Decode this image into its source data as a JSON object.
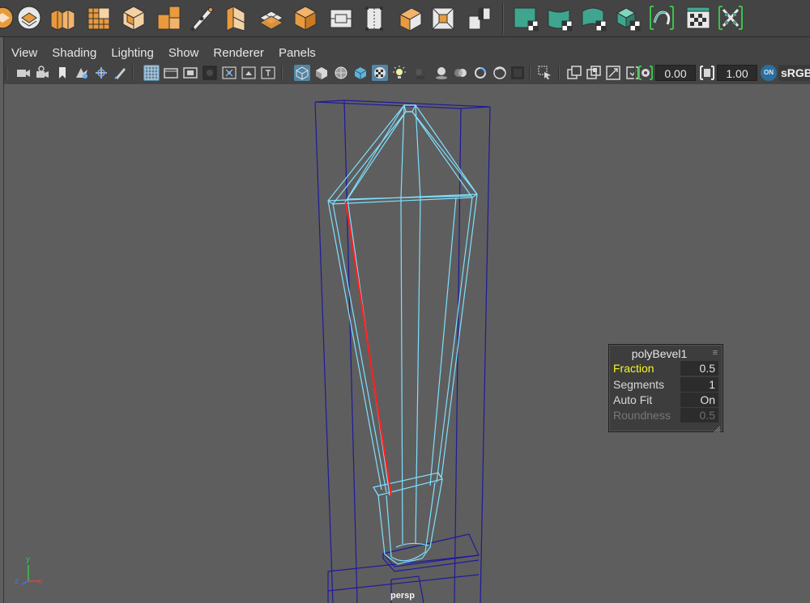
{
  "shelf": {
    "icons": [
      "poly-sphere-icon",
      "poly-cylinder-icon",
      "cube-group-icon",
      "grid-plane-icon",
      "cube-outline-icon",
      "cube-split-icon",
      "pen-edge-icon",
      "cube-slice-icon",
      "grid-bevel-icon",
      "cube-orange-icon",
      "bridge-icon",
      "extrude-outline-icon",
      "merge-icon",
      "target-icon",
      "offset-loop-icon",
      "uv-planar-icon",
      "uv-cylindrical-icon",
      "uv-spherical-icon",
      "uv-auto-icon",
      "uv-unfold-icon",
      "uv-layout-icon",
      "uv-cut-icon"
    ]
  },
  "menu": {
    "view": "View",
    "shading": "Shading",
    "lighting": "Lighting",
    "show": "Show",
    "renderer": "Renderer",
    "panels": "Panels"
  },
  "toolbar": {
    "gamma_value": "0.00",
    "exposure_value": "1.00",
    "color_space": "sRGB",
    "on_badge": "ON"
  },
  "viewport": {
    "camera_label": "persp",
    "axis_y": "y",
    "axis_z": "z",
    "axis_x": "x"
  },
  "hud": {
    "title": "polyBevel1",
    "rows": [
      {
        "label": "Fraction",
        "value": "0.5",
        "state": "highlight"
      },
      {
        "label": "Segments",
        "value": "1",
        "state": "normal"
      },
      {
        "label": "Auto Fit",
        "value": "On",
        "state": "normal"
      },
      {
        "label": "Roundness",
        "value": "0.5",
        "state": "disabled"
      }
    ]
  },
  "colors": {
    "wireframe": "#7fe0ff",
    "bounding_box": "#1f1a9a",
    "selected_edge": "#ff2020",
    "highlight_label": "#f5f52a",
    "shelf_orange": "#e89a3c",
    "shelf_teal": "#3fa58f",
    "viewport_bg": "#5e5e5e"
  }
}
